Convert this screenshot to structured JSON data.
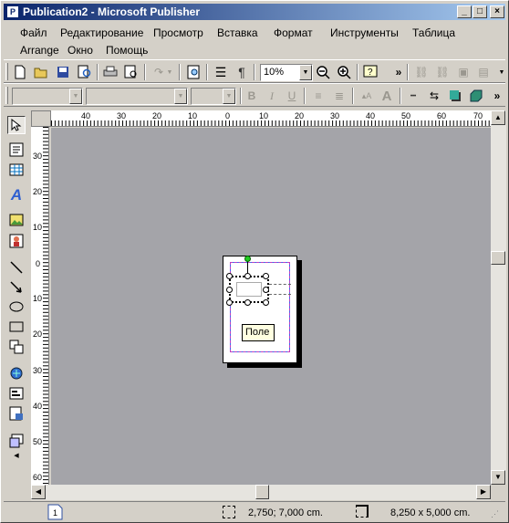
{
  "window": {
    "title": "Publication2 - Microsoft Publisher",
    "app_icon_text": "P",
    "controls": {
      "minimize": "_",
      "maximize": "□",
      "close": "×"
    }
  },
  "menu": {
    "row1": [
      "Файл",
      "Редактирование",
      "Просмотр",
      "Вставка",
      "Формат",
      "Инструменты",
      "Таблица"
    ],
    "row2": [
      "Arrange",
      "Окно",
      "Помощь"
    ]
  },
  "toolbar_standard": {
    "zoom_value": "10%",
    "overflow_glyph": "»",
    "paragraph_glyph": "¶"
  },
  "toolbar_format": {
    "bold_label": "B",
    "italic_label": "I",
    "underline_label": "U",
    "font_grow_label": "A",
    "overflow_glyph": "»"
  },
  "rulers": {
    "horizontal_labels": [
      "40",
      "30",
      "20",
      "10",
      "0",
      "10",
      "20",
      "30",
      "40",
      "50",
      "60",
      "70"
    ],
    "vertical_labels": [
      "30",
      "20",
      "10",
      "0",
      "10",
      "20",
      "30",
      "40",
      "50",
      "60"
    ]
  },
  "canvas": {
    "tooltip_text": "Поле"
  },
  "statusbar": {
    "page_number": "1",
    "position": "2,750; 7,000 cm.",
    "size": "8,250 x  5,000 cm."
  },
  "colors": {
    "titlebar_start": "#0a246a",
    "titlebar_end": "#a6caf0",
    "workspace": "#a4a4a9",
    "guide_blue": "#3a6df0",
    "guide_magenta": "#c040c0",
    "rotate_handle": "#22cc22"
  }
}
